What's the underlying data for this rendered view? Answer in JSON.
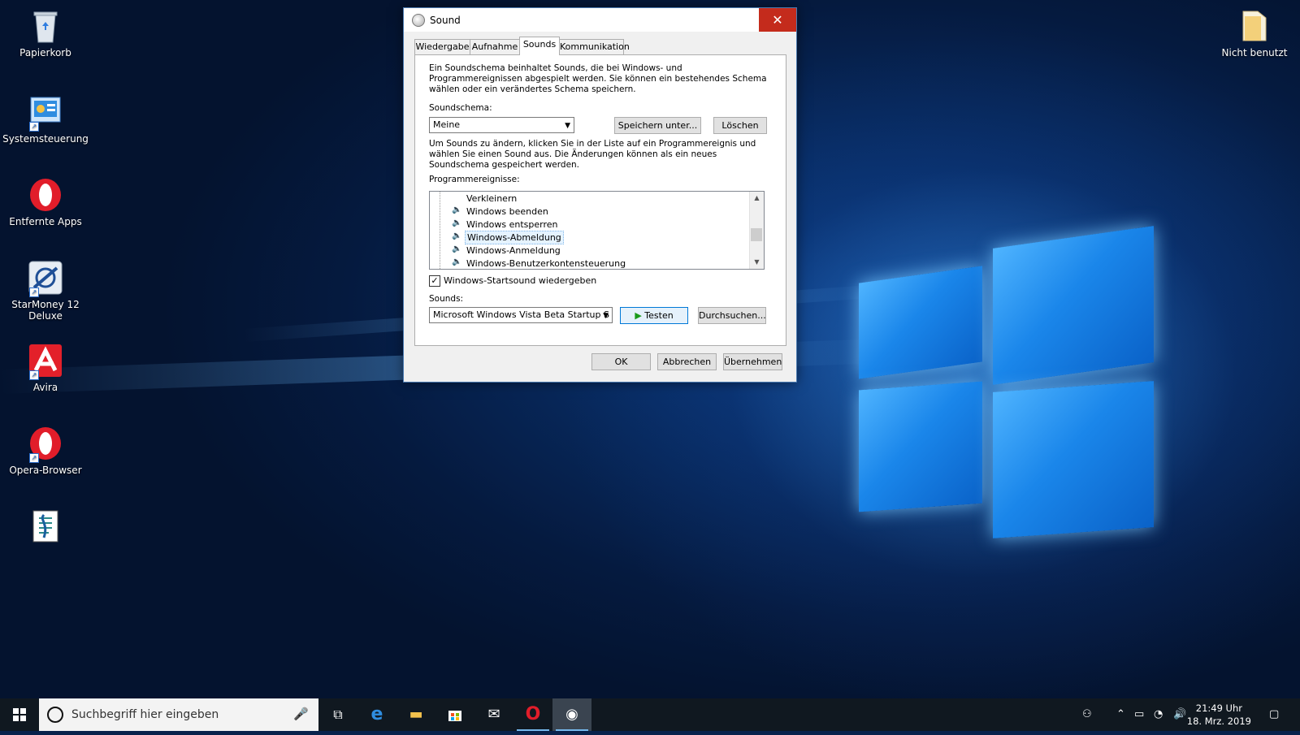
{
  "desktop": {
    "icons": [
      {
        "label": "Papierkorb",
        "icon": "recycle-bin-icon"
      },
      {
        "label": "Systemsteuerung",
        "icon": "control-panel-icon"
      },
      {
        "label": "Entfernte Apps",
        "icon": "opera-icon"
      },
      {
        "label": "StarMoney 12 Deluxe",
        "icon": "starmoney-icon"
      },
      {
        "label": "Avira",
        "icon": "avira-icon"
      },
      {
        "label": "Opera-Browser",
        "icon": "opera-icon"
      },
      {
        "label": "",
        "icon": "script-file-icon"
      }
    ],
    "right_icon": {
      "label": "Nicht benutzt",
      "icon": "folder-icon"
    }
  },
  "dialog": {
    "title": "Sound",
    "close_glyph": "✕",
    "tabs": [
      "Wiedergabe",
      "Aufnahme",
      "Sounds",
      "Kommunikation"
    ],
    "active_tab": "Sounds",
    "intro_text": [
      "Ein Soundschema beinhaltet Sounds, die bei Windows- und",
      "Programmereignissen abgespielt werden. Sie können ein bestehendes Schema",
      "wählen oder ein verändertes Schema speichern."
    ],
    "scheme_label": "Soundschema:",
    "scheme_value": "Meine",
    "save_as_label": "Speichern unter...",
    "delete_label": "Löschen",
    "change_text": [
      "Um Sounds zu ändern, klicken Sie in der Liste auf ein Programmereignis und",
      "wählen Sie einen Sound aus. Die Änderungen können als ein neues",
      "Soundschema gespeichert werden."
    ],
    "events_label": "Programmereignisse:",
    "events": [
      "Verkleinern",
      "Windows beenden",
      "Windows entsperren",
      "Windows-Abmeldung",
      "Windows-Anmeldung",
      "Windows-Benutzerkontensteuerung"
    ],
    "selected_event": "Windows-Abmeldung",
    "startup_checkbox_label": "Windows-Startsound wiedergeben",
    "startup_checked": true,
    "sounds_label": "Sounds:",
    "sound_value": "Microsoft Windows Vista Beta Startup S",
    "test_label": "Testen",
    "browse_label": "Durchsuchen...",
    "ok_label": "OK",
    "cancel_label": "Abbrechen",
    "apply_label": "Übernehmen"
  },
  "taskbar": {
    "search_placeholder": "Suchbegriff hier eingeben",
    "time": "21:49 Uhr",
    "date": "18. Mrz. 2019",
    "pinned": [
      "task-view-icon",
      "edge-icon",
      "file-explorer-icon",
      "store-icon",
      "mail-icon",
      "opera-icon",
      "sound-app-icon"
    ]
  },
  "colors": {
    "accent": "#0078d7",
    "close_button": "#c42b1c",
    "taskbar": "#101820"
  }
}
